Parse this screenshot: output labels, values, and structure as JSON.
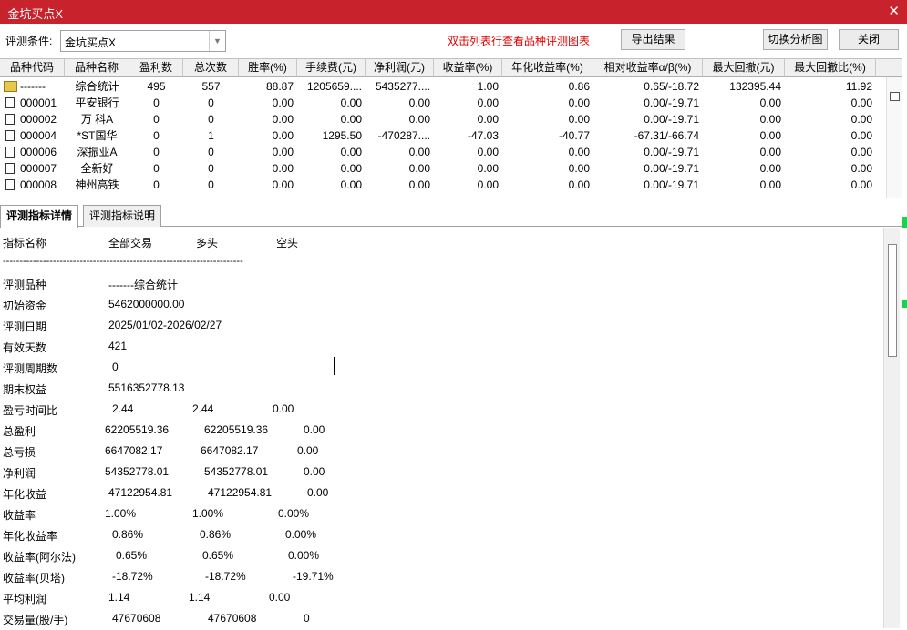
{
  "window": {
    "title": "-金坑买点X",
    "close_glyph": "✕"
  },
  "toolbar": {
    "condition_label": "评测条件:",
    "condition_value": "金坑买点X",
    "hint": "双击列表行查看品种评测图表",
    "export_label": "导出结果",
    "switch_chart_label": "切换分析图",
    "close_label": "关闭"
  },
  "table": {
    "columns": [
      "品种代码",
      "品种名称",
      "盈利数",
      "总次数",
      "胜率(%)",
      "手续费(元)",
      "净利润(元)",
      "收益率(%)",
      "年化收益率(%)",
      "相对收益率α/β(%)",
      "最大回撤(元)",
      "最大回撤比(%)"
    ],
    "rows": [
      {
        "code": "-------",
        "name": "综合统计",
        "win": "495",
        "total": "557",
        "rate": "88.87",
        "fee": "1205659....",
        "net": "5435277....",
        "ret": "1.00",
        "annual": "0.86",
        "ab": "0.65/-18.72",
        "dd": "132395.44",
        "ddr": "11.92"
      },
      {
        "code": "000001",
        "name": "平安银行",
        "win": "0",
        "total": "0",
        "rate": "0.00",
        "fee": "0.00",
        "net": "0.00",
        "ret": "0.00",
        "annual": "0.00",
        "ab": "0.00/-19.71",
        "dd": "0.00",
        "ddr": "0.00"
      },
      {
        "code": "000002",
        "name": "万 科A",
        "win": "0",
        "total": "0",
        "rate": "0.00",
        "fee": "0.00",
        "net": "0.00",
        "ret": "0.00",
        "annual": "0.00",
        "ab": "0.00/-19.71",
        "dd": "0.00",
        "ddr": "0.00"
      },
      {
        "code": "000004",
        "name": "*ST国华",
        "win": "0",
        "total": "1",
        "rate": "0.00",
        "fee": "1295.50",
        "net": "-470287....",
        "ret": "-47.03",
        "annual": "-40.77",
        "ab": "-67.31/-66.74",
        "dd": "0.00",
        "ddr": "0.00"
      },
      {
        "code": "000006",
        "name": "深振业A",
        "win": "0",
        "total": "0",
        "rate": "0.00",
        "fee": "0.00",
        "net": "0.00",
        "ret": "0.00",
        "annual": "0.00",
        "ab": "0.00/-19.71",
        "dd": "0.00",
        "ddr": "0.00"
      },
      {
        "code": "000007",
        "name": "全新好",
        "win": "0",
        "total": "0",
        "rate": "0.00",
        "fee": "0.00",
        "net": "0.00",
        "ret": "0.00",
        "annual": "0.00",
        "ab": "0.00/-19.71",
        "dd": "0.00",
        "ddr": "0.00"
      },
      {
        "code": "000008",
        "name": "神州高铁",
        "win": "0",
        "total": "0",
        "rate": "0.00",
        "fee": "0.00",
        "net": "0.00",
        "ret": "0.00",
        "annual": "0.00",
        "ab": "0.00/-19.71",
        "dd": "0.00",
        "ddr": "0.00"
      }
    ]
  },
  "tabs": [
    "评测指标详情",
    "评测指标说明"
  ],
  "detail": {
    "headers": [
      "指标名称",
      "全部交易",
      "多头",
      "空头"
    ],
    "separator": "------------------------------------------------------------------------",
    "rows": [
      {
        "label": "评测品种",
        "all": "-------综合统计",
        "long": "",
        "short": ""
      },
      {
        "label": "初始资金",
        "all": "5462000000.00",
        "long": "",
        "short": ""
      },
      {
        "label": "评测日期",
        "all": "2025/01/02-2026/02/27",
        "long": "",
        "short": ""
      },
      {
        "label": "有效天数",
        "all": "421",
        "long": "",
        "short": ""
      },
      {
        "label": "评测周期数",
        "all": "0",
        "long": "",
        "short": ""
      },
      {
        "label": "期末权益",
        "all": "5516352778.13",
        "long": "",
        "short": ""
      },
      {
        "label": "盈亏时间比",
        "all": "2.44",
        "long": "2.44",
        "short": "0.00"
      },
      {
        "label": "总盈利",
        "all": "62205519.36",
        "long": "62205519.36",
        "short": "0.00"
      },
      {
        "label": "总亏损",
        "all": "6647082.17",
        "long": "6647082.17",
        "short": "0.00"
      },
      {
        "label": "净利润",
        "all": "54352778.01",
        "long": "54352778.01",
        "short": "0.00"
      },
      {
        "label": "年化收益",
        "all": "47122954.81",
        "long": "47122954.81",
        "short": "0.00"
      },
      {
        "label": "收益率",
        "all": "1.00%",
        "long": "1.00%",
        "short": "0.00%"
      },
      {
        "label": "年化收益率",
        "all": "0.86%",
        "long": "0.86%",
        "short": "0.00%"
      },
      {
        "label": "收益率(阿尔法)",
        "all": "0.65%",
        "long": "0.65%",
        "short": "0.00%"
      },
      {
        "label": "收益率(贝塔)",
        "all": "-18.72%",
        "long": "-18.72%",
        "short": "-19.71%"
      },
      {
        "label": "平均利润",
        "all": "1.14",
        "long": "1.14",
        "short": "0.00"
      },
      {
        "label": "交易量(股/手)",
        "all": "47670608",
        "long": "47670608",
        "short": "0"
      }
    ]
  },
  "colors": {
    "titlebar": "#c8232c",
    "hint": "#e00000",
    "accent_green": "#1fd14a"
  }
}
